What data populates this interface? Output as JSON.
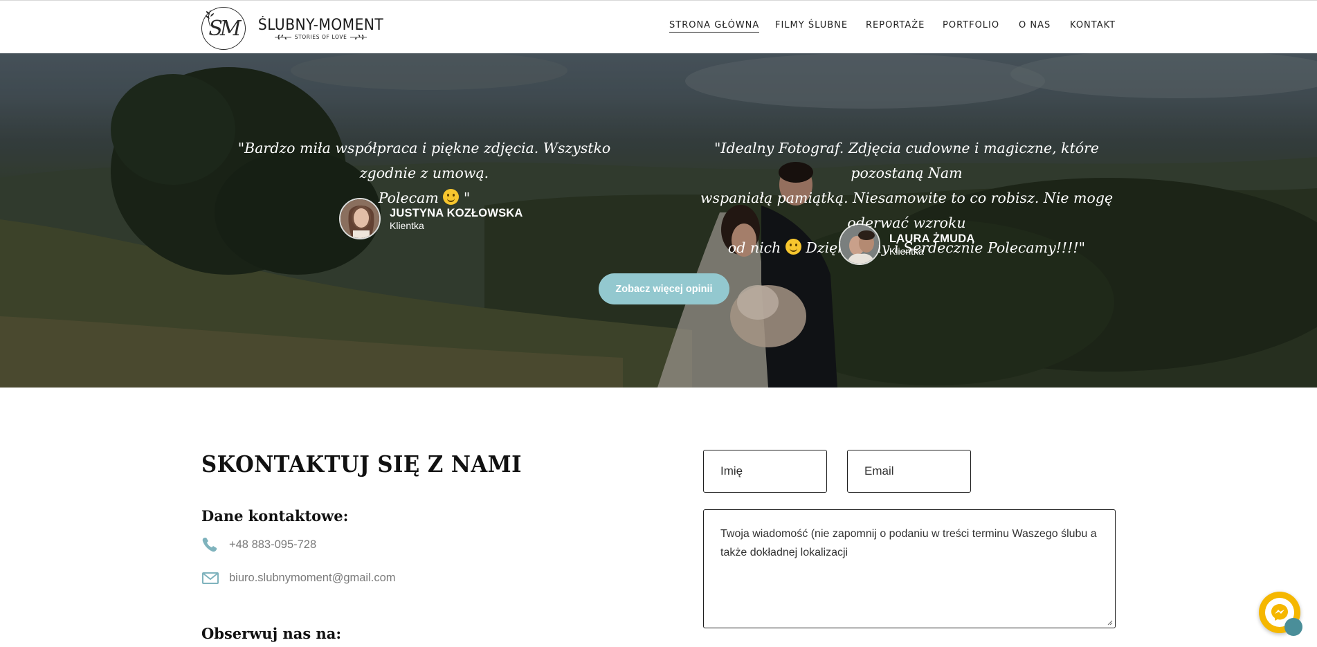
{
  "header": {
    "logo_monogram": "SM",
    "logo_name": "ŚLUBNY-MOMENT",
    "logo_tagline": "STORIES OF LOVE"
  },
  "nav": {
    "items": [
      {
        "label": "STRONA GŁÓWNA",
        "active": true
      },
      {
        "label": "FILMY ŚLUBNE",
        "active": false
      },
      {
        "label": "REPORTAŻE",
        "active": false
      },
      {
        "label": "PORTFOLIO",
        "active": false
      },
      {
        "label": "O NAS",
        "active": false
      },
      {
        "label": "KONTAKT",
        "active": false
      }
    ]
  },
  "testimonials": [
    {
      "quote_line1": "\"Bardzo miła współpraca i piękne zdjęcia. Wszystko zgodnie z umową.",
      "quote_line2_pre": "Polecam ",
      "quote_line2_post": " \"",
      "name": "JUSTYNA KOZŁOWSKA",
      "role": "Klientka"
    },
    {
      "quote_line1": "\"Idealny Fotograf. Zdjęcia cudowne i magiczne, które pozostaną Nam",
      "quote_line2": "wspaniałą pamiątką. Niesamowite to co robisz. Nie mogę oderwać wzroku",
      "quote_line3_pre": "od nich ",
      "quote_line3_post": " Dziękujemy i Serdecznie Polecamy!!!!\"",
      "name": "LAURA ŻMUDA",
      "role": "Klientka"
    }
  ],
  "more_button": "Zobacz więcej opinii",
  "contact": {
    "title": "SKONTAKTUJ SIĘ Z NAMI",
    "details_heading": "Dane kontaktowe:",
    "phone": "+48 883-095-728",
    "email": "biuro.slubnymoment@gmail.com",
    "follow_heading": "Obserwuj nas na:",
    "phone_icon": "phone-icon",
    "email_icon": "envelope-icon"
  },
  "form": {
    "name_placeholder": "Imię",
    "email_placeholder": "Email",
    "message_placeholder": "Twoja wiadomość (nie zapomnij o podaniu w treści terminu Waszego ślubu a także dokładnej lokalizacji"
  },
  "colors": {
    "accent": "#93c8cf",
    "icon": "#7fb3bd",
    "messenger": "#f5b700"
  }
}
